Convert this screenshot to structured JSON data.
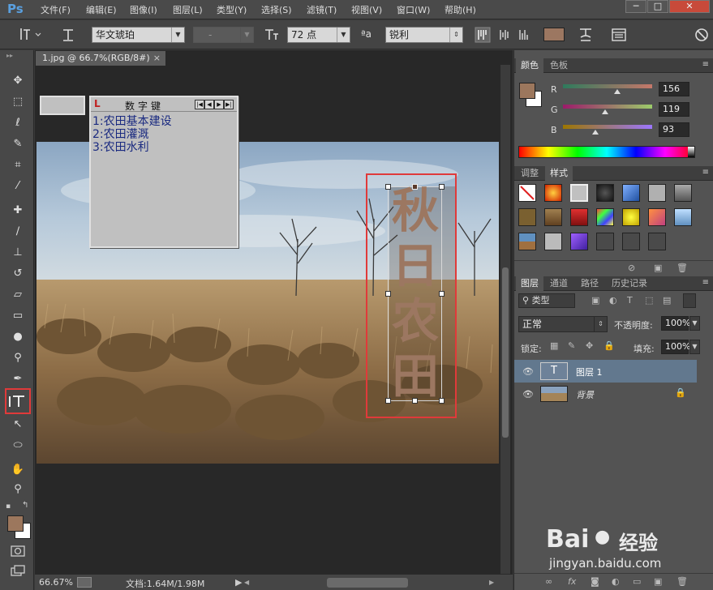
{
  "app": {
    "logo": "Ps"
  },
  "menu": [
    "文件(F)",
    "编辑(E)",
    "图像(I)",
    "图层(L)",
    "类型(Y)",
    "选择(S)",
    "滤镜(T)",
    "视图(V)",
    "窗口(W)",
    "帮助(H)"
  ],
  "window_controls": {
    "minimize": "─",
    "restore": "□",
    "close": "✕"
  },
  "options": {
    "font_family": "华文琥珀",
    "font_style": "-",
    "font_size": "72 点",
    "aa_label": "ªa",
    "antialias": "锐利",
    "text_color": "#9c7761"
  },
  "document": {
    "tab_title": "1.jpg @ 66.7%(RGB/8#)",
    "tab_close": "×",
    "vertical_text": [
      "秋",
      "日",
      "农",
      "田"
    ],
    "text_color": "#9c7761"
  },
  "ime": {
    "title": "数字键",
    "nav_buttons": [
      "|◀",
      "◀",
      "▶",
      "▶|"
    ],
    "items": [
      "1:农田基本建设",
      "2:农田灌溉",
      "3:农田水利"
    ]
  },
  "status": {
    "zoom": "66.67%",
    "doc_info": "文档:1.64M/1.98M"
  },
  "color_panel": {
    "tabs": [
      "颜色",
      "色板"
    ],
    "r_label": "R",
    "g_label": "G",
    "b_label": "B",
    "r": "156",
    "g": "119",
    "b": "93",
    "r_level": 0.61,
    "g_level": 0.47,
    "b_level": 0.36,
    "fg": "#9c775d",
    "bg": "#ffffff"
  },
  "styles_panel": {
    "tabs": [
      "调整",
      "样式"
    ]
  },
  "layers_panel": {
    "tabs": [
      "图层",
      "通道",
      "路径",
      "历史记录"
    ],
    "filter_kind": "类型",
    "blend_mode": "正常",
    "opacity_label": "不透明度:",
    "opacity": "100%",
    "lock_label": "锁定:",
    "fill_label": "填充:",
    "fill": "100%",
    "layers": [
      {
        "name": "图层 1",
        "thumb": "T",
        "selected": true
      },
      {
        "name": "背景",
        "thumb": "",
        "selected": false
      }
    ]
  },
  "watermark": {
    "brand": "Bai",
    "brand2": "经验",
    "url": "jingyan.baidu.com"
  }
}
